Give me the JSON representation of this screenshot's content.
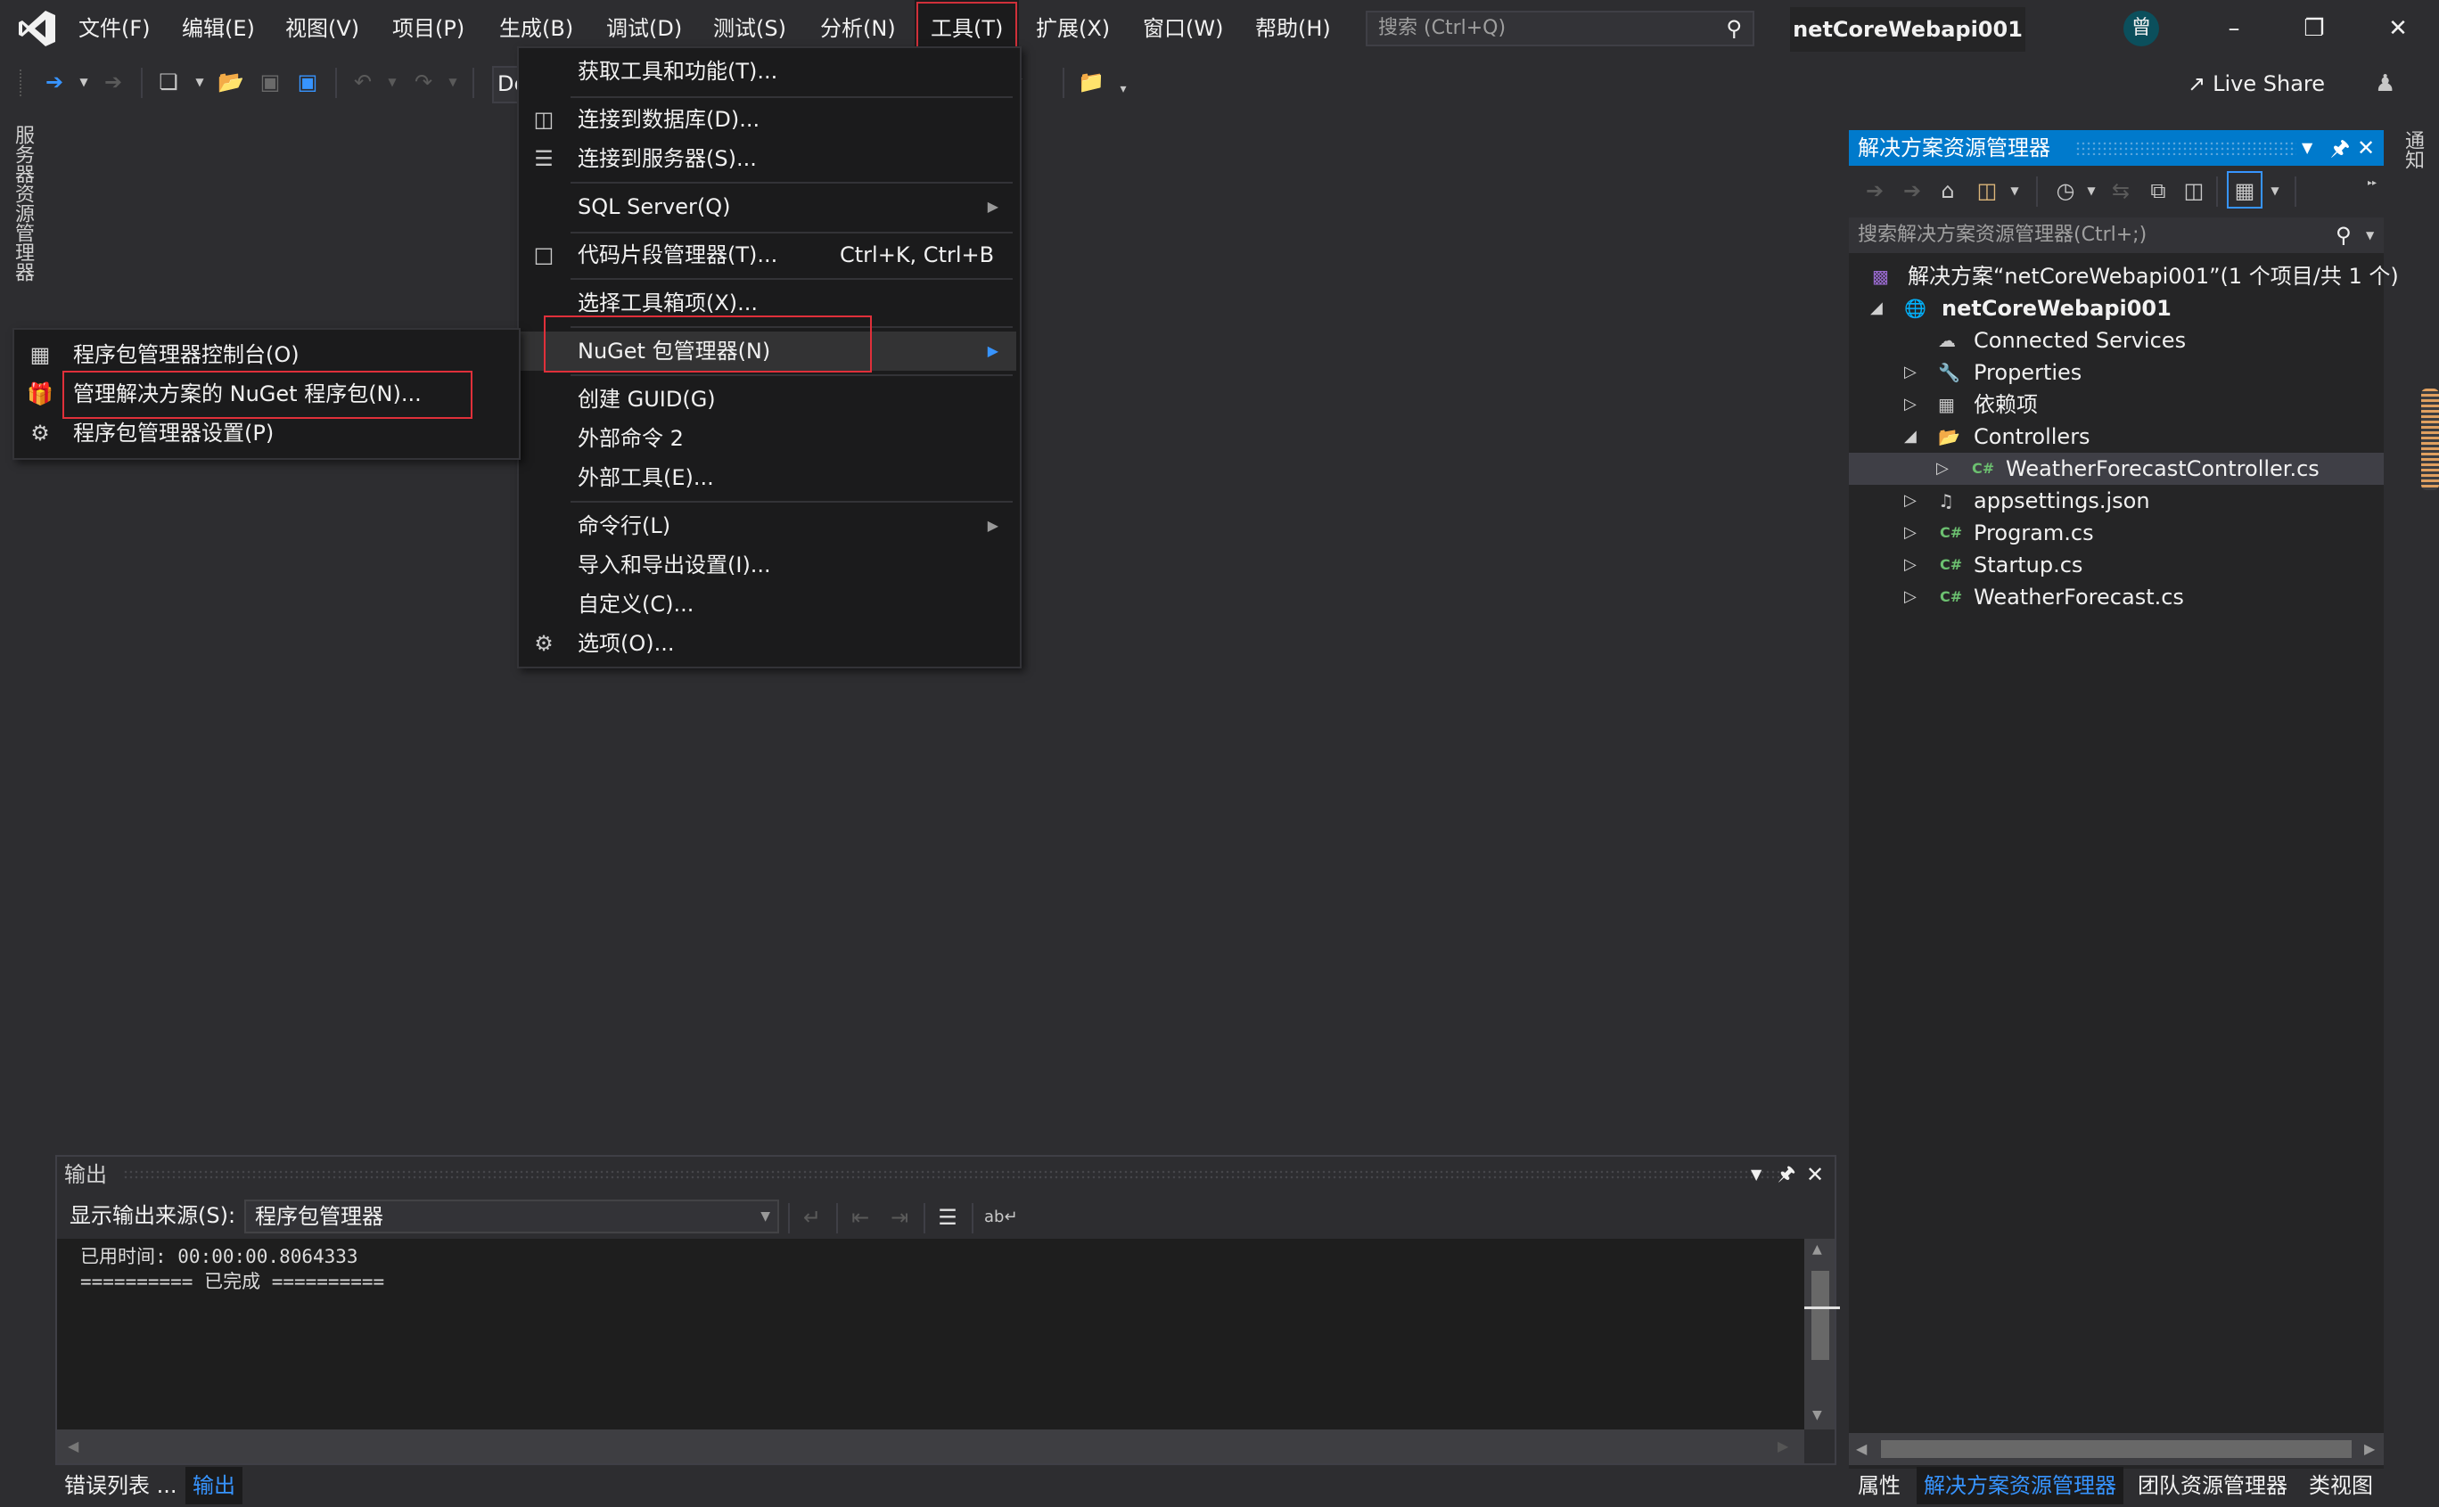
{
  "window": {
    "title": "netCoreWebapi001",
    "avatar_initial": "曾",
    "search_placeholder": "搜索 (Ctrl+Q)",
    "controls": {
      "minimize": "–",
      "restore": "❐",
      "close": "✕"
    }
  },
  "menubar": [
    {
      "label": "文件(F)"
    },
    {
      "label": "编辑(E)"
    },
    {
      "label": "视图(V)"
    },
    {
      "label": "项目(P)"
    },
    {
      "label": "生成(B)"
    },
    {
      "label": "调试(D)"
    },
    {
      "label": "测试(S)"
    },
    {
      "label": "分析(N)"
    },
    {
      "label": "工具(T)",
      "open": true
    },
    {
      "label": "扩展(X)"
    },
    {
      "label": "窗口(W)"
    },
    {
      "label": "帮助(H)"
    }
  ],
  "toolbar": {
    "config_dropdown_partial": "De",
    "live_share_label": "Live Share"
  },
  "left_tabs": {
    "server_explorer": "服务器资源管理器"
  },
  "tools_menu": {
    "items": [
      {
        "label": "获取工具和功能(T)...",
        "icon": ""
      },
      {
        "label": "连接到数据库(D)...",
        "icon": "database-connect-icon"
      },
      {
        "label": "连接到服务器(S)...",
        "icon": "server-connect-icon"
      },
      {
        "label": "SQL Server(Q)",
        "submenu": true
      },
      {
        "label": "代码片段管理器(T)...",
        "shortcut": "Ctrl+K, Ctrl+B",
        "icon": "snippet-icon"
      },
      {
        "label": "选择工具箱项(X)..."
      },
      {
        "label": "NuGet 包管理器(N)",
        "submenu": true,
        "highlighted": true
      },
      {
        "label": "创建 GUID(G)"
      },
      {
        "label": "外部命令 2"
      },
      {
        "label": "外部工具(E)..."
      },
      {
        "label": "命令行(L)",
        "submenu": true
      },
      {
        "label": "导入和导出设置(I)..."
      },
      {
        "label": "自定义(C)..."
      },
      {
        "label": "选项(O)...",
        "icon": "gear-icon"
      }
    ]
  },
  "nuget_submenu": {
    "items": [
      {
        "label": "程序包管理器控制台(O)",
        "icon": "console-icon"
      },
      {
        "label": "管理解决方案的 NuGet 程序包(N)...",
        "icon": "package-icon",
        "boxed": true
      },
      {
        "label": "程序包管理器设置(P)",
        "icon": "gear-icon"
      }
    ]
  },
  "solution_explorer": {
    "title": "解决方案资源管理器",
    "search_placeholder": "搜索解决方案资源管理器(Ctrl+;)",
    "tree": [
      {
        "label": "解决方案“netCoreWebapi001”(1 个项目/共 1 个)",
        "level": 0,
        "icon": "solution-icon",
        "expander": ""
      },
      {
        "label": "netCoreWebapi001",
        "level": 1,
        "icon": "web-project-icon",
        "expander": "expanded",
        "bold": true
      },
      {
        "label": "Connected Services",
        "level": 2,
        "icon": "cloud-plug-icon",
        "expander": ""
      },
      {
        "label": "Properties",
        "level": 2,
        "icon": "wrench-icon",
        "expander": "collapsed"
      },
      {
        "label": "依赖项",
        "level": 2,
        "icon": "dependencies-icon",
        "expander": "collapsed"
      },
      {
        "label": "Controllers",
        "level": 2,
        "icon": "folder-open-icon",
        "expander": "expanded"
      },
      {
        "label": "WeatherForecastController.cs",
        "level": 3,
        "icon": "csharp-file-icon",
        "expander": "collapsed",
        "selected": true
      },
      {
        "label": "appsettings.json",
        "level": 2,
        "icon": "json-file-icon",
        "expander": "collapsed"
      },
      {
        "label": "Program.cs",
        "level": 2,
        "icon": "csharp-file-icon",
        "expander": "collapsed"
      },
      {
        "label": "Startup.cs",
        "level": 2,
        "icon": "csharp-file-icon",
        "expander": "collapsed"
      },
      {
        "label": "WeatherForecast.cs",
        "level": 2,
        "icon": "csharp-file-icon",
        "expander": "collapsed"
      }
    ]
  },
  "right_tabs": {
    "notifications": "通知"
  },
  "output_panel": {
    "title": "输出",
    "source_label": "显示输出来源(S):",
    "source_value": "程序包管理器",
    "lines": [
      "已用时间: 00:00:00.8064333",
      "========== 已完成 =========="
    ]
  },
  "bottom_tabs_left": [
    {
      "label": "错误列表 ...",
      "active": false
    },
    {
      "label": "输出",
      "active": true
    }
  ],
  "bottom_tabs_right": [
    {
      "label": "属性",
      "active": false
    },
    {
      "label": "解决方案资源管理器",
      "active": true
    },
    {
      "label": "团队资源管理器",
      "active": false
    },
    {
      "label": "类视图",
      "active": false
    }
  ],
  "colors": {
    "accent": "#007acc",
    "active_tab_text": "#3794ff",
    "highlight_box": "#e0303a",
    "background": "#2d2d30",
    "menu_background": "#1b1b1c"
  }
}
